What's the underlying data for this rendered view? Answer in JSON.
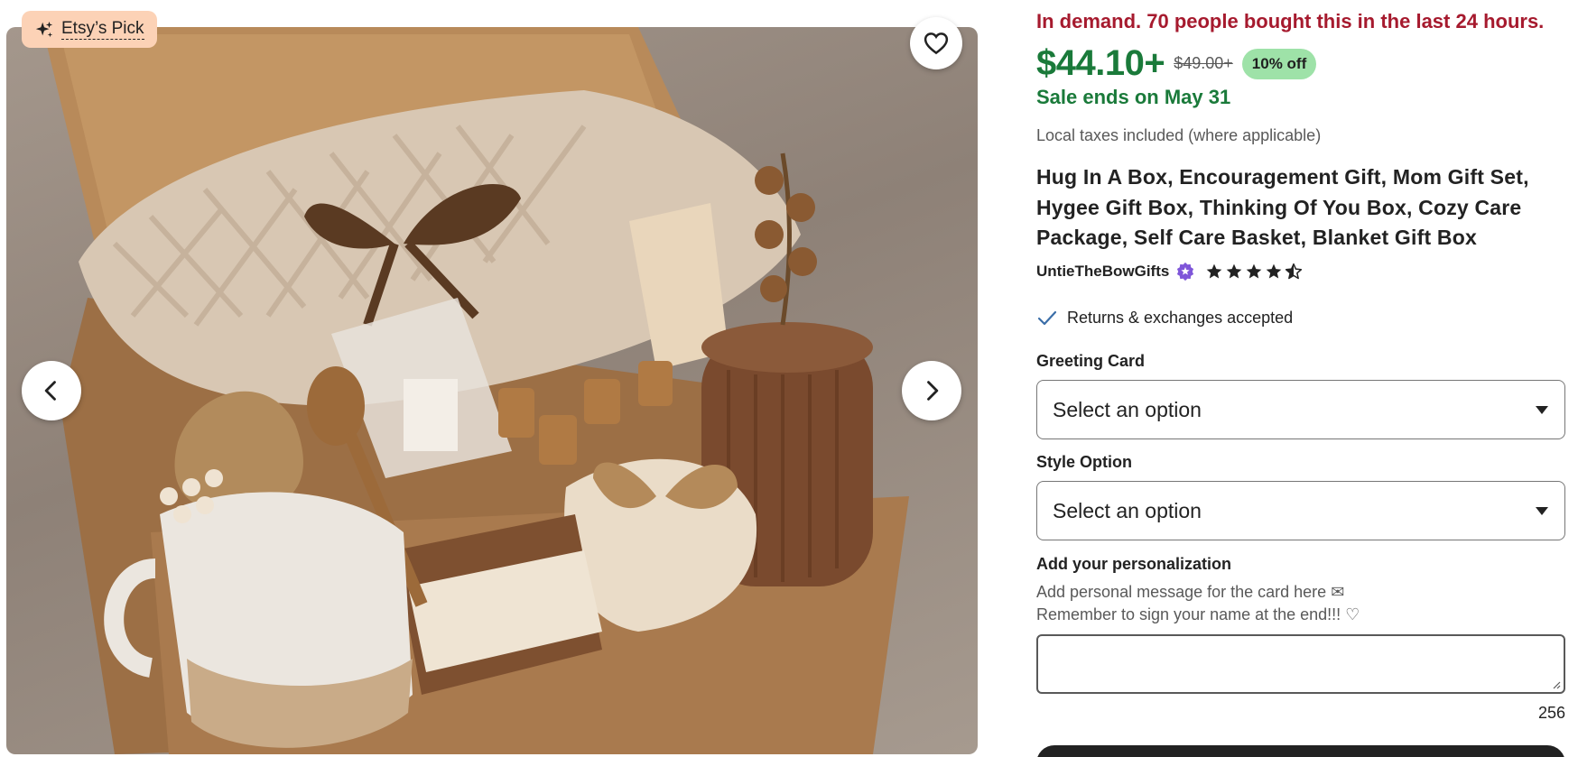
{
  "badge": {
    "label": "Etsy’s Pick",
    "icon": "sparkle-icon"
  },
  "image": {
    "alt": "Hug in a box gift set"
  },
  "demand_text": "In demand. 70 people bought this in the last 24 hours.",
  "price": {
    "current": "$44.10+",
    "original": "$49.00+",
    "discount": "10% off"
  },
  "sale_ends": "Sale ends on May 31",
  "taxes_note": "Local taxes included (where applicable)",
  "title": "Hug In A Box, Encouragement Gift, Mom Gift Set, Hygee Gift Box, Thinking Of You Box, Cozy Care Package, Self Care Basket, Blanket Gift Box",
  "shop": {
    "name": "UntieTheBowGifts",
    "rating": 4.5,
    "star_color": "#222222",
    "badge_color": "#7f56d9"
  },
  "returns": "Returns & exchanges accepted",
  "greeting_card": {
    "label": "Greeting Card",
    "value": "Select an option"
  },
  "style_option": {
    "label": "Style Option",
    "value": "Select an option"
  },
  "personalization": {
    "label": "Add your personalization",
    "hint_line1": "Add personal message for the card here ✉",
    "hint_line2": "Remember to sign your name at the end!!! ♡",
    "value": "",
    "counter": "256"
  },
  "colors": {
    "sale_green": "#1a7a3a",
    "demand_red": "#a61a2e",
    "discount_bg": "#9ee2a8",
    "badge_bg": "#fcd2b6"
  }
}
